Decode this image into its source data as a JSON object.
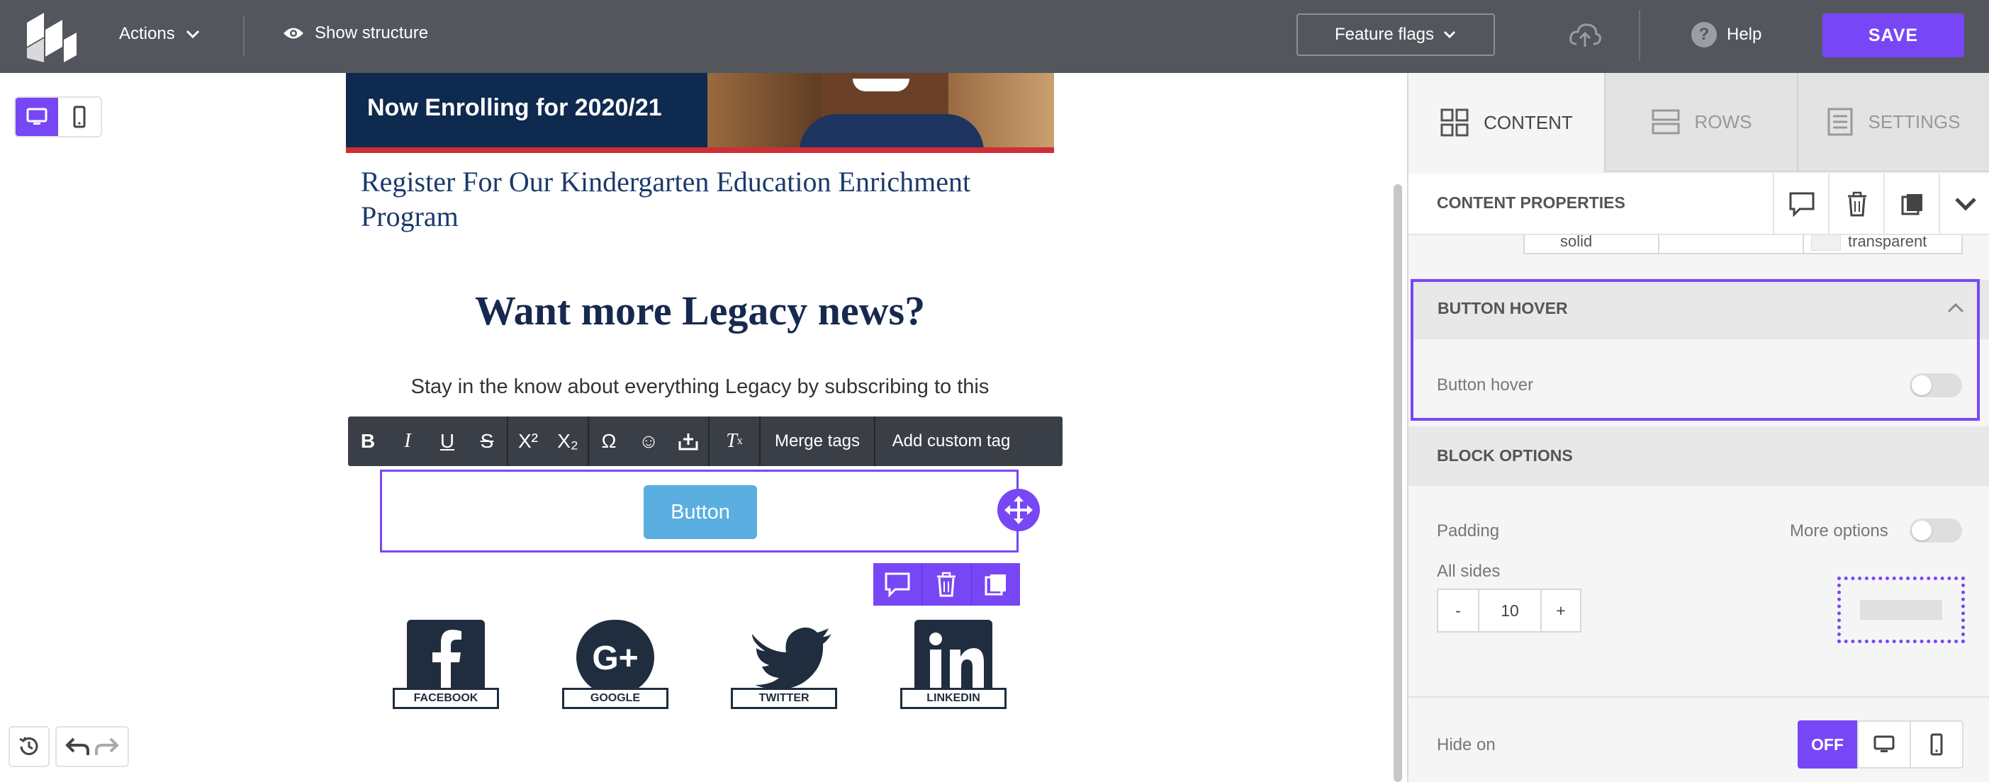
{
  "topbar": {
    "actions_label": "Actions",
    "show_structure_label": "Show structure",
    "feature_flags_label": "Feature flags",
    "help_label": "Help",
    "save_label": "SAVE"
  },
  "canvas": {
    "hero_text": "Now Enrolling for 2020/21",
    "register_heading": "Register For Our Kindergarten Education Enrichment Program",
    "want_heading": "Want more Legacy news?",
    "stay_text": "Stay in the know about everything Legacy by subscribing to this",
    "button_label": "Button",
    "social": [
      {
        "label": "FACEBOOK",
        "icon": "facebook-icon"
      },
      {
        "label": "GOOGLE",
        "icon": "google-plus-icon"
      },
      {
        "label": "TWITTER",
        "icon": "twitter-icon"
      },
      {
        "label": "LINKEDIN",
        "icon": "linkedin-icon"
      }
    ]
  },
  "toolbar": {
    "merge_tags_label": "Merge tags",
    "add_custom_tag_label": "Add custom tag"
  },
  "panel": {
    "tabs": [
      {
        "label": "CONTENT",
        "active": true
      },
      {
        "label": "ROWS",
        "active": false
      },
      {
        "label": "SETTINGS",
        "active": false
      }
    ],
    "content_properties_title": "CONTENT PROPERTIES",
    "border_style_value": "solid",
    "border_color_value": "transparent",
    "button_hover": {
      "section_title": "BUTTON HOVER",
      "label": "Button hover",
      "enabled": false
    },
    "block_options": {
      "section_title": "BLOCK OPTIONS",
      "padding_label": "Padding",
      "more_options_label": "More options",
      "all_sides_label": "All sides",
      "padding_value": "10",
      "minus_label": "-",
      "plus_label": "+",
      "hide_on_label": "Hide on",
      "off_label": "OFF"
    }
  },
  "colors": {
    "accent": "#7747f5",
    "topbar": "#53565c",
    "button": "#5aaee0",
    "hero_navy": "#0f2a4f"
  }
}
